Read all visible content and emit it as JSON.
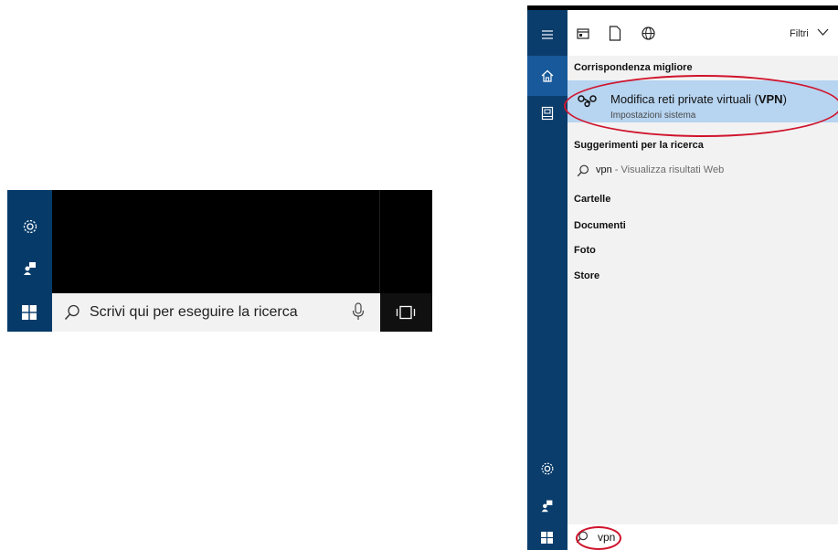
{
  "left_taskbar": {
    "search_placeholder": "Scrivi qui per eseguire la ricerca",
    "rail_icons": [
      "gear-icon",
      "person-icon"
    ],
    "start_icon": "windows-logo-icon",
    "mic_icon": "microphone-icon",
    "taskview_icon": "task-view-icon"
  },
  "search_panel": {
    "header": {
      "filter_label": "Filtri",
      "tab_icons": [
        "apps-icon",
        "documents-icon",
        "web-icon"
      ]
    },
    "best_match": {
      "section_label": "Corrispondenza migliore",
      "title_prefix": "Modifica reti private virtuali (",
      "title_bold": "VPN",
      "title_suffix": ")",
      "subtitle": "Impostazioni sistema",
      "icon": "vpn-icon"
    },
    "suggestions": {
      "section_label": "Suggerimenti per la ricerca",
      "items": [
        {
          "term": "vpn",
          "separator": " - ",
          "hint": "Visualizza risultati Web"
        }
      ]
    },
    "categories": [
      "Cartelle",
      "Documenti",
      "Foto",
      "Store"
    ],
    "query": "vpn"
  },
  "colors": {
    "rail": "#0a3d6b",
    "rail_selected": "#17599a",
    "highlight": "#b7d4f0",
    "annotation": "#d0142c"
  }
}
